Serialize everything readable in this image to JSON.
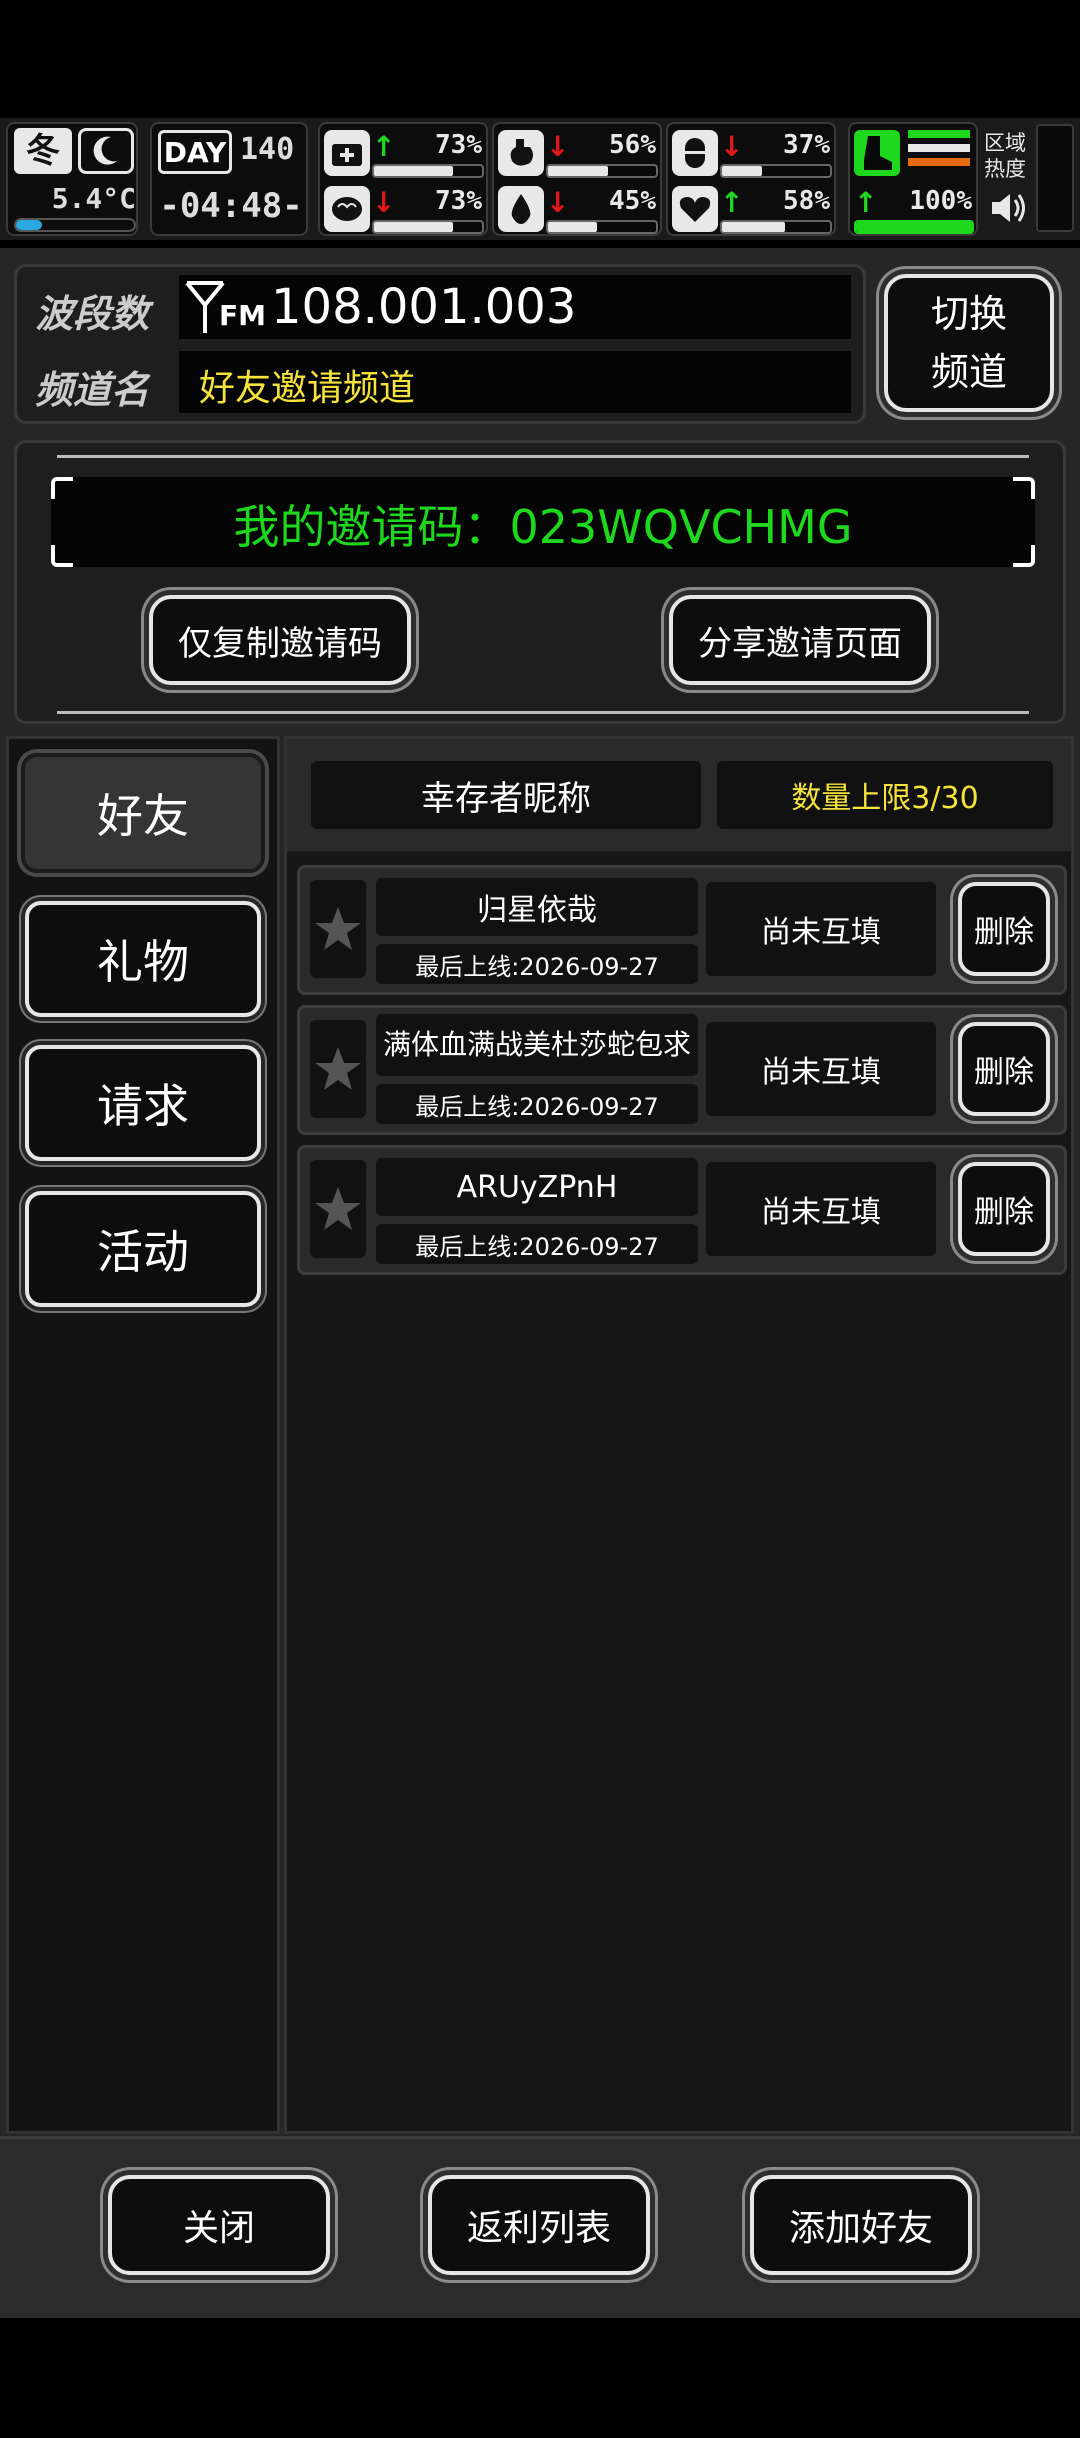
{
  "hud": {
    "season": "冬",
    "temperature": "5.4°C",
    "day_label": "DAY",
    "day_value": "140",
    "clock": "-04:48-",
    "stats_left": [
      {
        "name": "health-icon",
        "pct": "73%",
        "trend": "up",
        "level": 0.73
      },
      {
        "name": "brain-icon",
        "pct": "73%",
        "trend": "down",
        "level": 0.73
      }
    ],
    "stats_mid": [
      {
        "name": "stomach-icon",
        "pct": "56%",
        "trend": "down",
        "level": 0.56
      },
      {
        "name": "water-drop-icon",
        "pct": "45%",
        "trend": "down",
        "level": 0.45
      }
    ],
    "stats_right": [
      {
        "name": "pill-icon",
        "pct": "37%",
        "trend": "down",
        "level": 0.37
      },
      {
        "name": "heart-icon",
        "pct": "58%",
        "trend": "up",
        "level": 0.58
      }
    ],
    "stamina": {
      "pct": "100%",
      "trend": "up",
      "level": 1.0
    },
    "region_label": "区域\n热度"
  },
  "radio": {
    "band_label": "波段数",
    "band_value": "108.001.003",
    "fm_label": "FM",
    "channel_label": "频道名",
    "channel_value": "好友邀请频道",
    "switch_button": "切换\n频道"
  },
  "invite": {
    "code_text": "我的邀请码：023WQVCHMG",
    "copy_button": "仅复制邀请码",
    "share_button": "分享邀请页面"
  },
  "tabs": [
    "好友",
    "礼物",
    "请求",
    "活动"
  ],
  "friends": {
    "header_name": "幸存者昵称",
    "header_limit": "数量上限3/30",
    "rows": [
      {
        "name": "归星依哉",
        "last_online": "最后上线:2026-09-27",
        "status": "尚未互填",
        "delete": "删除"
      },
      {
        "name": "满体血满战美杜莎蛇包求",
        "last_online": "最后上线:2026-09-27",
        "status": "尚未互填",
        "delete": "删除"
      },
      {
        "name": "ARUyZPnH",
        "last_online": "最后上线:2026-09-27",
        "status": "尚未互填",
        "delete": "删除"
      }
    ]
  },
  "footer": {
    "close": "关闭",
    "rebate": "返利列表",
    "add_friend": "添加好友"
  },
  "colors": {
    "green": "#1ed81e",
    "yellow": "#f5e23a",
    "red": "#e01818"
  }
}
